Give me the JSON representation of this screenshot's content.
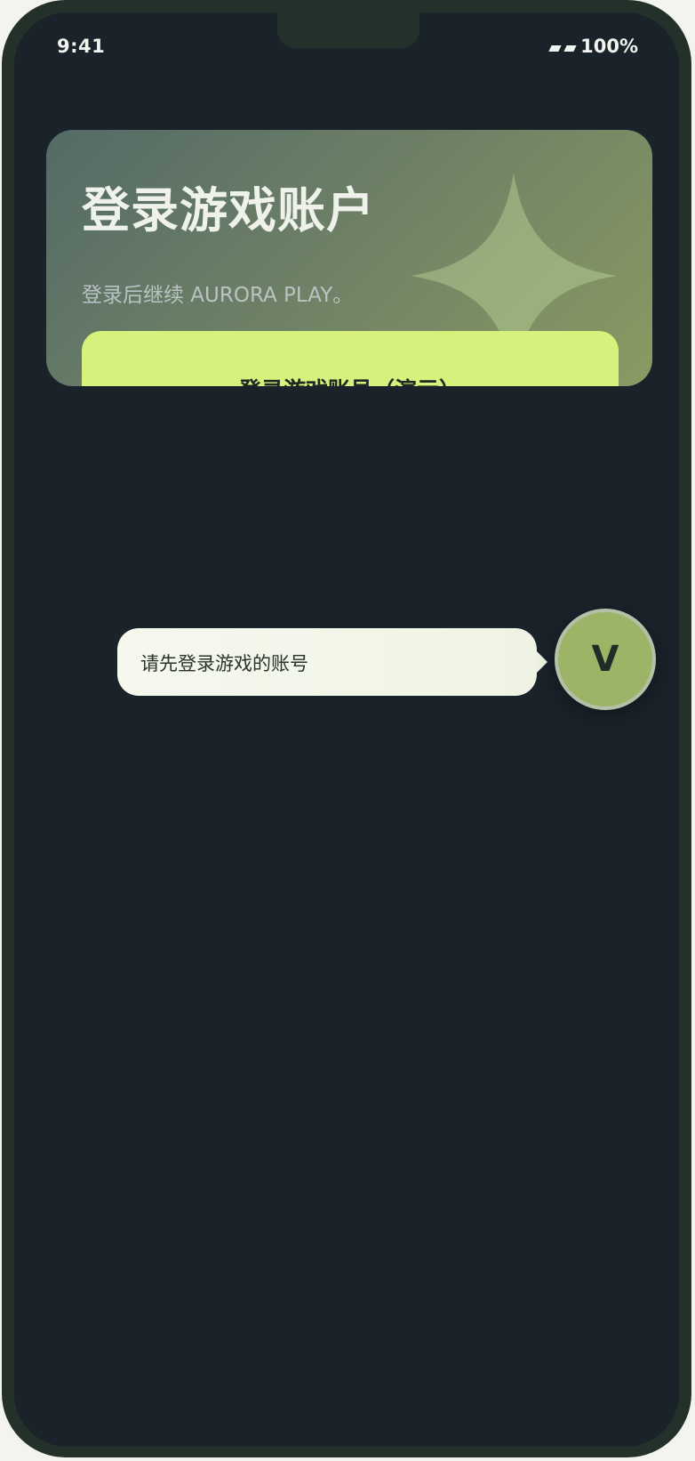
{
  "status_bar": {
    "time": "9:41",
    "battery": "100%"
  },
  "login_card": {
    "title": "登录游戏账户",
    "subtitle": "登录后继续 AURORA PLAY。",
    "button_label": "登录游戏账号（演示）",
    "decoration_icon": "four-point-star-icon"
  },
  "assistant": {
    "tooltip_text": "请先登录游戏的账号",
    "avatar_letter": "V"
  },
  "colors": {
    "screen_background": "#1a222a",
    "button_accent": "#d6f27c",
    "avatar": "#9cb466",
    "tooltip": "#f6f8ee"
  }
}
